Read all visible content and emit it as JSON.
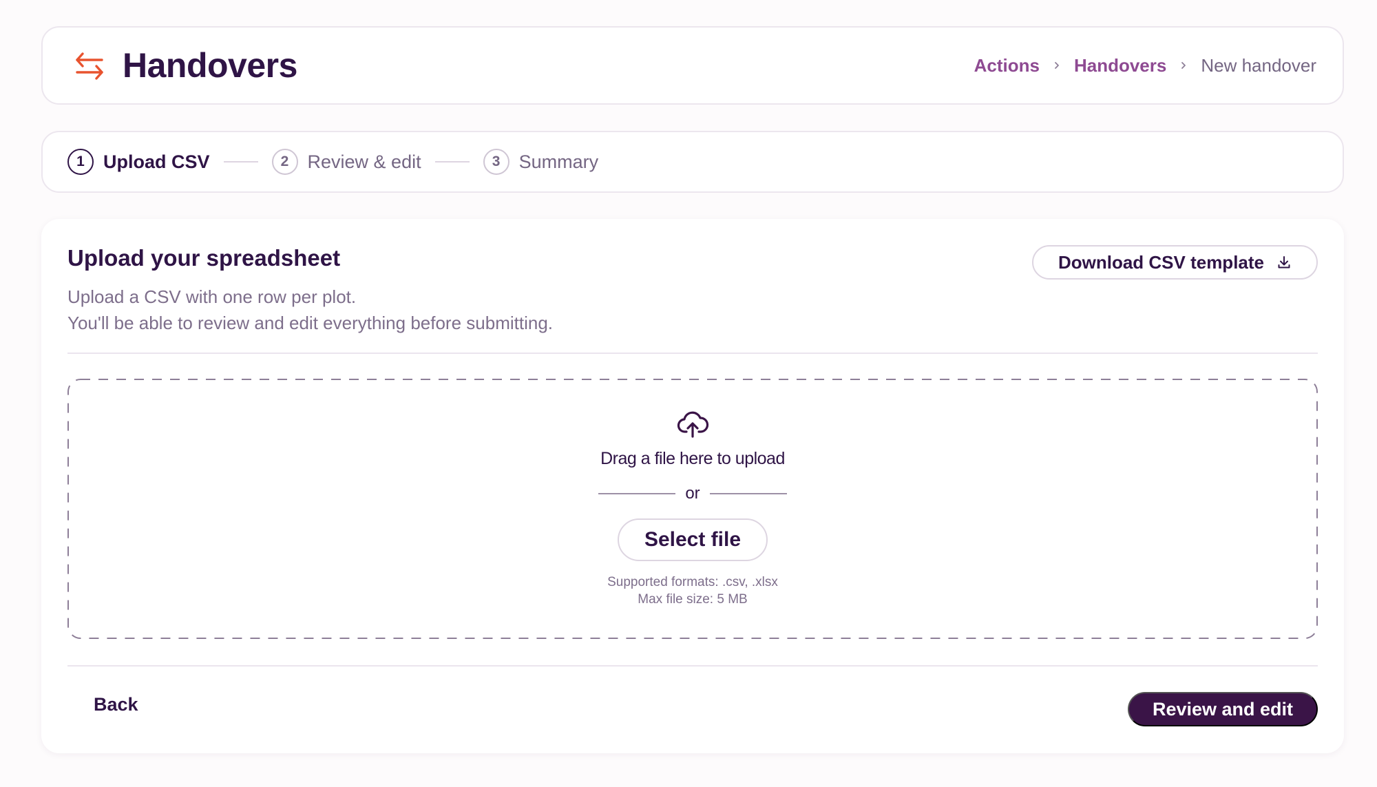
{
  "header": {
    "title": "Handovers",
    "icon": "swap-arrows-icon",
    "icon_color": "#e8532f",
    "breadcrumb": {
      "items": [
        {
          "label": "Actions"
        },
        {
          "label": "Handovers"
        }
      ],
      "current": "New handover"
    }
  },
  "stepper": {
    "steps": [
      {
        "number": "1",
        "label": "Upload CSV",
        "active": true
      },
      {
        "number": "2",
        "label": "Review & edit",
        "active": false
      },
      {
        "number": "3",
        "label": "Summary",
        "active": false
      }
    ]
  },
  "main": {
    "title": "Upload your spreadsheet",
    "description_lines": [
      "Upload a CSV with one row per plot.",
      "You'll be able to review and edit everything before submitting."
    ],
    "download_button": {
      "label": "Download CSV template",
      "icon": "download-icon"
    },
    "dropzone": {
      "icon": "cloud-upload-icon",
      "text": "Drag a file here to upload",
      "or_text": "or",
      "select_button": "Select file",
      "formats": "Supported formats: .csv, .xlsx",
      "max_size": "Max file size: 5 MB"
    },
    "back_button": "Back",
    "primary_button": "Review and edit"
  },
  "colors": {
    "brand_dark": "#3a1447",
    "link": "#8e4a92",
    "accent": "#e8532f"
  }
}
